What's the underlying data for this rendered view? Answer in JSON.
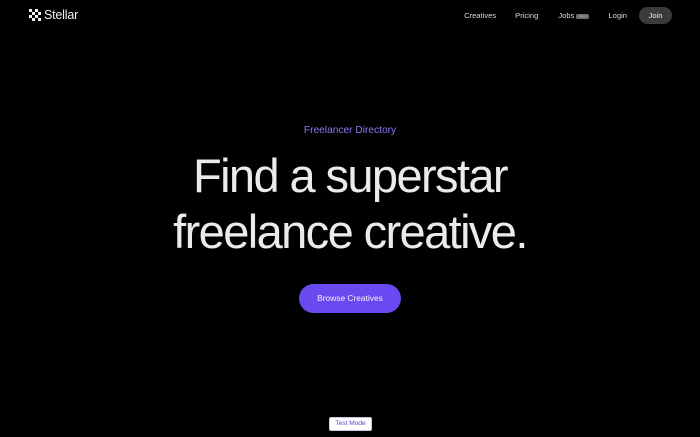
{
  "brand": {
    "name": "Stellar",
    "logo_icon": "stellar-checker-logo"
  },
  "nav": {
    "items": [
      {
        "label": "Creatives"
      },
      {
        "label": "Pricing"
      },
      {
        "label": "Jobs",
        "badge": "Soon"
      },
      {
        "label": "Login"
      }
    ],
    "join_label": "Join"
  },
  "hero": {
    "eyebrow": "Freelancer Directory",
    "title_line1": "Find a superstar",
    "title_line2": "freelance creative.",
    "cta_label": "Browse Creatives"
  },
  "footer": {
    "test_mode_label": "Test Mode"
  },
  "colors": {
    "background": "#000000",
    "accent": "#6a49f0",
    "eyebrow": "#8b7bf2",
    "join_button": "#3a3a3a"
  }
}
